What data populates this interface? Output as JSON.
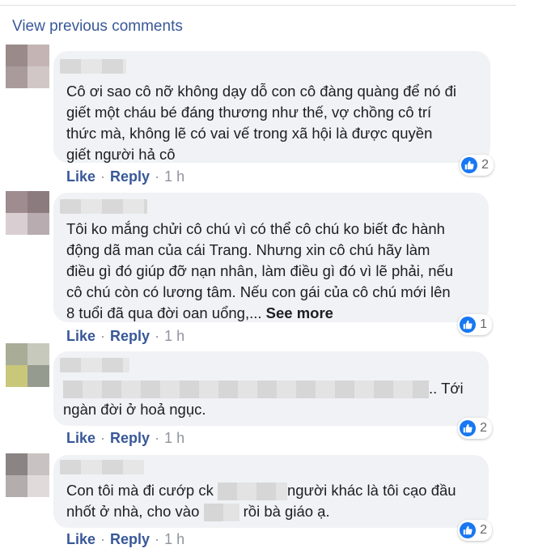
{
  "view_previous": "View previous comments",
  "actions": {
    "like": "Like",
    "reply": "Reply",
    "separator": "·"
  },
  "comments": [
    {
      "text": "Cô ơi sao cô nỡ không dạy dỗ con cô đàng quàng để nó đi\ngiết một cháu bé đáng thương như thế, vợ chồng cô trí\nthức mà, không lẽ có vai vế trong xã hội là được quyền\ngiết người hả cô",
      "time": "1 h",
      "reactions": "2",
      "avatar_colors": [
        "#9a8a8a",
        "#c4b4b4",
        "#a99b9b",
        "#d2c7c7"
      ]
    },
    {
      "text": "Tôi ko mắng chửi cô chú vì có thể cô chú ko biết đc hành\nđộng dã man của cái Trang. Nhưng xin cô chú hãy làm\nđiều gì đó giúp đỡ nạn nhân, làm điều gì đó vì lẽ phải, nếu\ncô chú còn có lương tâm. Nếu con gái của cô chú mới lên\n8 tuổi đã qua đời oan uổng,... ",
      "see_more": "See more",
      "time": "1 h",
      "reactions": "1",
      "avatar_colors": [
        "#9e8c90",
        "#8b7a7e",
        "#d9cfd2",
        "#b9acb0"
      ]
    },
    {
      "text_line1_suffix": ".. Tới",
      "text_line2": "ngàn đời ở hoả ngục.",
      "time": "1 h",
      "reactions": "2",
      "avatar_colors": [
        "#a9ad98",
        "#c7c9bd",
        "#c9c77a",
        "#969b8f"
      ]
    },
    {
      "text_part1": "Con tôi mà đi cướp ck ",
      "text_part2": "người khác là tôi cạo đầu",
      "text_line2_part1": "nhốt ở nhà, cho vào ",
      "text_line2_part2": "rồi bà giáo ạ.",
      "time": "1 h",
      "reactions": "2",
      "avatar_colors": [
        "#8a8484",
        "#c8c2c2",
        "#b3adad",
        "#e0dada"
      ]
    }
  ],
  "colors": {
    "link": "#385898",
    "bubble": "#f0f2f5",
    "like_blue": "#1877f2",
    "muted": "#90949c"
  }
}
